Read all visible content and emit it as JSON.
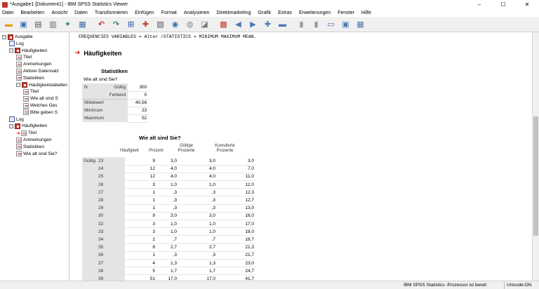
{
  "window": {
    "title": "*Ausgabe1 [Dokument1] - IBM SPSS Statistics Viewer",
    "minimize": "–",
    "maximize": "☐",
    "close": "✕"
  },
  "menu": [
    "Datei",
    "Bearbeiten",
    "Ansicht",
    "Daten",
    "Transformieren",
    "Einfügen",
    "Format",
    "Analysieren",
    "Direktmarketing",
    "Grafik",
    "Extras",
    "Erweiterungen",
    "Fenster",
    "Hilfe"
  ],
  "toolbar": {
    "icons": [
      "open-folder-icon",
      "save-icon",
      "print-icon",
      "print-preview-icon",
      "export-icon",
      "recall-dialog-icon",
      "undo-icon",
      "redo-icon",
      "goto-data-icon",
      "goto-case-icon",
      "goto-variable-icon",
      "variables-icon",
      "select-cases-icon",
      "insert-output-icon",
      "hide-icon",
      "promote-icon",
      "demote-icon",
      "expand-icon",
      "collapse-icon",
      "show-icon",
      "hide-all-icon",
      "insert-heading-icon",
      "insert-title-icon",
      "insert-text-icon"
    ]
  },
  "outline": {
    "items": [
      {
        "label": "Ausgabe",
        "level": 0,
        "icon": "book",
        "expander": "−"
      },
      {
        "label": "Log",
        "level": 1,
        "icon": "log"
      },
      {
        "label": "Häufigkeiten",
        "level": 1,
        "icon": "book",
        "expander": "−"
      },
      {
        "label": "Titel",
        "level": 2,
        "icon": "doc"
      },
      {
        "label": "Anmerkungen",
        "level": 2,
        "icon": "doc"
      },
      {
        "label": "Aktiver Datensatz",
        "level": 2,
        "icon": "doc"
      },
      {
        "label": "Statistiken",
        "level": 2,
        "icon": "doc"
      },
      {
        "label": "Häufigkeitstabellen",
        "level": 2,
        "icon": "book",
        "expander": "−"
      },
      {
        "label": "Titel",
        "level": 3,
        "icon": "doc"
      },
      {
        "label": "Wie alt sind S",
        "level": 3,
        "icon": "doc"
      },
      {
        "label": "Welches Ges",
        "level": 3,
        "icon": "doc"
      },
      {
        "label": "Bitte geben S",
        "level": 3,
        "icon": "doc"
      },
      {
        "label": "Log",
        "level": 1,
        "icon": "log"
      },
      {
        "label": "Häufigkeiten",
        "level": 1,
        "icon": "book",
        "expander": "−"
      },
      {
        "label": "Titel",
        "level": 2,
        "icon": "doc",
        "current": true
      },
      {
        "label": "Anmerkungen",
        "level": 2,
        "icon": "doc"
      },
      {
        "label": "Statistiken",
        "level": 2,
        "icon": "doc"
      },
      {
        "label": "Wie alt sind Sie?",
        "level": 2,
        "icon": "doc"
      }
    ]
  },
  "viewer": {
    "syntax": "FREQUENCIES VARIABLES = Alter /STATISTICS = MINIMUM MAXIMUM MEAN.",
    "section_title": "Häufigkeiten",
    "statistics": {
      "title": "Statistiken",
      "subtitle": "Wie alt sind Sie?",
      "rows": [
        [
          "N",
          "Gültig",
          "300"
        ],
        [
          "",
          "Fehlend",
          "0"
        ],
        [
          "Mittelwert",
          "",
          "40,56"
        ],
        [
          "Minimum",
          "",
          "23"
        ],
        [
          "Maximum",
          "",
          "52"
        ]
      ]
    },
    "frequency": {
      "title": "Wie alt sind Sie?",
      "headers": [
        "Häufigkeit",
        "Prozent",
        "Gültige\nProzente",
        "Kumulierte\nProzente"
      ],
      "group": "Gültig",
      "rows": [
        [
          "23",
          "9",
          "3,0",
          "3,0",
          "3,0"
        ],
        [
          "24",
          "12",
          "4,0",
          "4,0",
          "7,0"
        ],
        [
          "25",
          "12",
          "4,0",
          "4,0",
          "11,0"
        ],
        [
          "26",
          "3",
          "1,0",
          "1,0",
          "12,0"
        ],
        [
          "27",
          "1",
          ",3",
          ",3",
          "12,3"
        ],
        [
          "28",
          "1",
          ",3",
          ",3",
          "12,7"
        ],
        [
          "29",
          "1",
          ",3",
          ",3",
          "13,0"
        ],
        [
          "30",
          "9",
          "3,0",
          "3,0",
          "16,0"
        ],
        [
          "32",
          "3",
          "1,0",
          "1,0",
          "17,0"
        ],
        [
          "33",
          "3",
          "1,0",
          "1,0",
          "18,0"
        ],
        [
          "34",
          "2",
          ",7",
          ",7",
          "18,7"
        ],
        [
          "35",
          "8",
          "2,7",
          "2,7",
          "21,3"
        ],
        [
          "36",
          "1",
          ",3",
          ",3",
          "21,7"
        ],
        [
          "37",
          "4",
          "1,3",
          "1,3",
          "23,0"
        ],
        [
          "38",
          "5",
          "1,7",
          "1,7",
          "24,7"
        ],
        [
          "39",
          "51",
          "17,0",
          "17,0",
          "41,7"
        ]
      ]
    }
  },
  "status": {
    "processor": "IBM SPSS Statistics -Prozessor ist bereit",
    "unicode": "Unicode:ON"
  },
  "colors": {
    "accent_red": "#d6281e",
    "header_grey": "#e4e4e4"
  }
}
